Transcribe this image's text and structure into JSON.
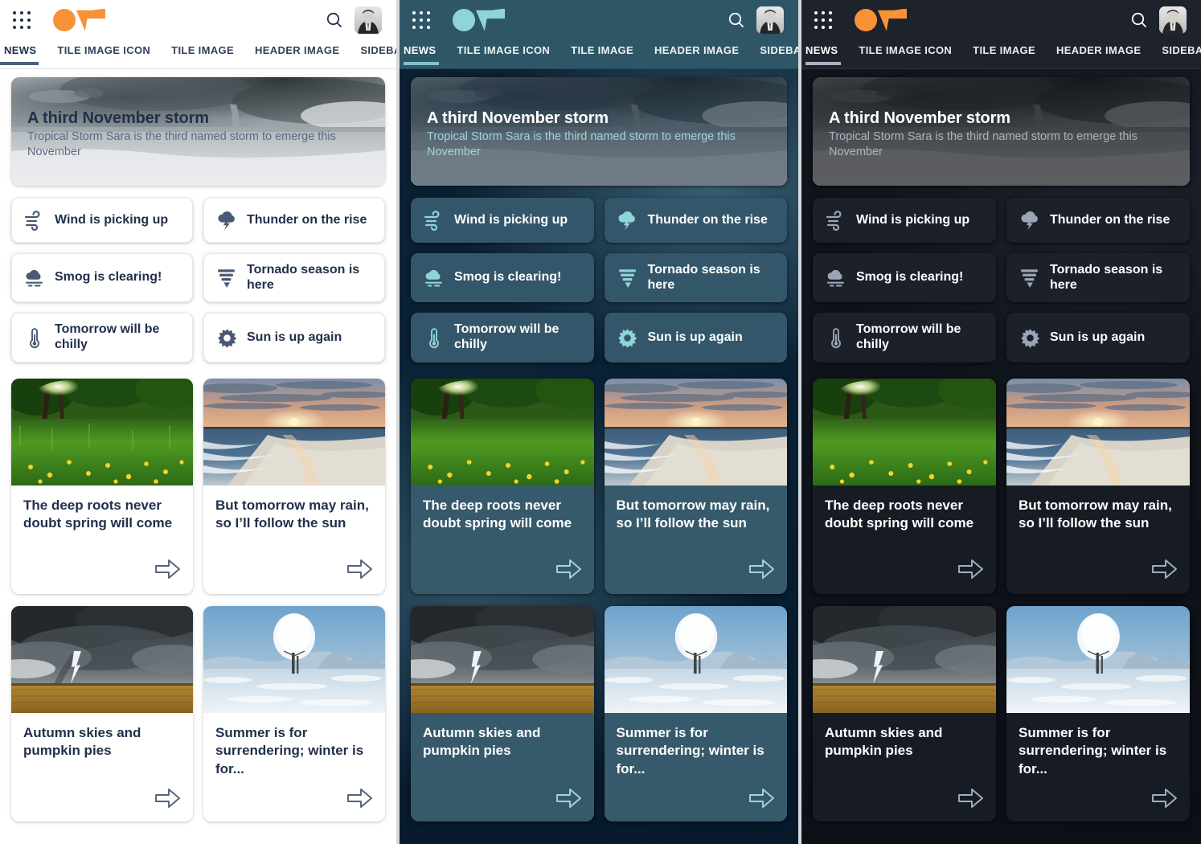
{
  "app": {
    "logo_name": "carbon-logo",
    "apps_icon": "grid-apps-icon",
    "search_icon": "search-icon",
    "avatar_icon": "user-avatar"
  },
  "tabs": [
    {
      "label": "NEWS",
      "active": true
    },
    {
      "label": "TILE IMAGE ICON",
      "active": false
    },
    {
      "label": "TILE IMAGE",
      "active": false
    },
    {
      "label": "HEADER IMAGE",
      "active": false
    },
    {
      "label": "SIDEBAR",
      "active": false
    }
  ],
  "hero": {
    "title": "A third November storm",
    "subtitle": "Tropical Storm Sara is the third named storm to emerge this November",
    "image": "tornado-over-ocean"
  },
  "chips": [
    {
      "label": "Wind is picking up",
      "icon": "wind-icon"
    },
    {
      "label": "Thunder on the rise",
      "icon": "thunderstorm-icon"
    },
    {
      "label": "Smog is clearing!",
      "icon": "smog-icon"
    },
    {
      "label": "Tornado season is here",
      "icon": "tornado-icon"
    },
    {
      "label": "Tomorrow will be chilly",
      "icon": "thermometer-icon"
    },
    {
      "label": "Sun is up again",
      "icon": "sun-icon"
    }
  ],
  "cards": [
    {
      "title": "The deep roots never doubt spring will come",
      "image": "spring-meadow-trees",
      "arrow": "arrow-right-icon"
    },
    {
      "title": "But tomorrow may rain, so I’ll follow the sun",
      "image": "beach-sunset",
      "arrow": "arrow-right-icon"
    },
    {
      "title": "Autumn skies and pumpkin pies",
      "image": "storm-clouds-over-field",
      "arrow": "arrow-right-icon"
    },
    {
      "title": "Summer is for surrendering; winter is for...",
      "image": "frozen-tree-winter",
      "arrow": "arrow-right-icon"
    }
  ],
  "themes": [
    {
      "name": "white",
      "header_bg": "#ffffff",
      "accent": "#46617e",
      "logo": "#f79236",
      "text": "#21304a"
    },
    {
      "name": "teal-dark",
      "header_bg": "#2e5667",
      "accent": "#7fc3cc",
      "logo": "#8fd4d6",
      "text": "#ffffff"
    },
    {
      "name": "near-black",
      "header_bg": "#1d222b",
      "accent": "#a9b4c2",
      "logo": "#f79236",
      "text": "#ffffff"
    }
  ]
}
